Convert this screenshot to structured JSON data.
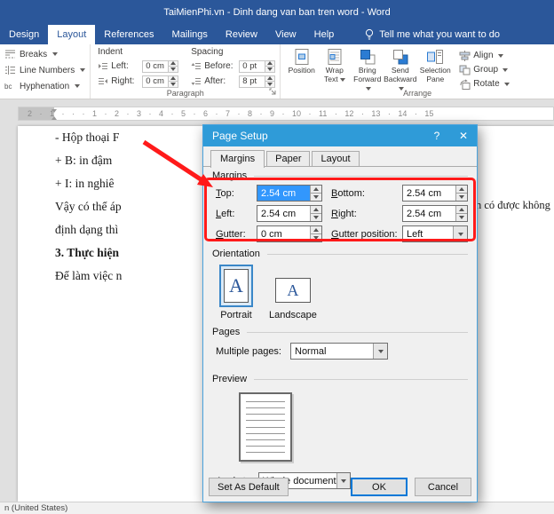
{
  "window": {
    "title": "TaiMienPhi.vn - Dinh dang van ban tren word - Word"
  },
  "tabs": {
    "design": "Design",
    "layout": "Layout",
    "references": "References",
    "mailings": "Mailings",
    "review": "Review",
    "view": "View",
    "help": "Help",
    "tell_me": "Tell me what you want to do"
  },
  "ribbon": {
    "breaks": "Breaks",
    "line_numbers": "Line Numbers",
    "hyphenation": "Hyphenation",
    "hyph_glyph": "bc",
    "indent": "Indent",
    "spacing": "Spacing",
    "left_label": "Left:",
    "left_value": "0 cm",
    "right_label": "Right:",
    "right_value": "0 cm",
    "before_label": "Before:",
    "before_value": "0 pt",
    "after_label": "After:",
    "after_value": "8 pt",
    "paragraph": "Paragraph",
    "arrange": "Arrange",
    "position": "Position",
    "wrap1": "Wrap",
    "wrap2": "Text",
    "bring1": "Bring",
    "bring2": "Forward",
    "send1": "Send",
    "send2": "Backward",
    "sel1": "Selection",
    "sel2": "Pane",
    "align": "Align",
    "group": "Group",
    "rotate": "Rotate"
  },
  "ruler": {
    "marks": "2 · 1 · · · 1 · 2 · 3 · 4 · 5 · 6 · 7 · 8 · 9 · 10 · 11 · 12 · 13 · 14 · 15"
  },
  "document": {
    "line1": "- Hộp thoại F",
    "line2": "+ B: in đậm",
    "line3": "+ I: in nghiê",
    "line4": "Vậy có thể áp",
    "line5": "định dạng thì",
    "line6": "3. Thực hiện",
    "line7": "Để làm việc n",
    "fragment": "n có được không"
  },
  "dialog": {
    "title": "Page Setup",
    "help_glyph": "?",
    "close_glyph": "✕",
    "tab_margins": "Margins",
    "tab_paper": "Paper",
    "tab_layout": "Layout",
    "sect_margins": "Margins",
    "top_label": "Top:",
    "top_value": "2.54 cm",
    "bottom_label": "Bottom:",
    "bottom_value": "2.54 cm",
    "left_label": "Left:",
    "left_value": "2.54 cm",
    "right_label": "Right:",
    "right_value": "2.54 cm",
    "gutter_label": "Gutter:",
    "gutter_value": "0 cm",
    "gutter_pos_label": "Gutter position:",
    "gutter_pos_value": "Left",
    "sect_orientation": "Orientation",
    "portrait": "Portrait",
    "landscape": "Landscape",
    "letter": "A",
    "sect_pages": "Pages",
    "multiple_pages_label": "Multiple pages:",
    "multiple_pages_value": "Normal",
    "sect_preview": "Preview",
    "apply_label": "Apply to:",
    "apply_value": "Whole document",
    "btn_default": "Set As Default",
    "btn_ok": "OK",
    "btn_cancel": "Cancel"
  },
  "status": {
    "language": "n (United States)"
  },
  "colors": {
    "title_bar": "#2b579a",
    "dialog_title_bar": "#2f9bd8",
    "annotation_red": "#ff1a1a",
    "selection_blue": "#3297fd",
    "default_button_border": "#0078d7"
  }
}
